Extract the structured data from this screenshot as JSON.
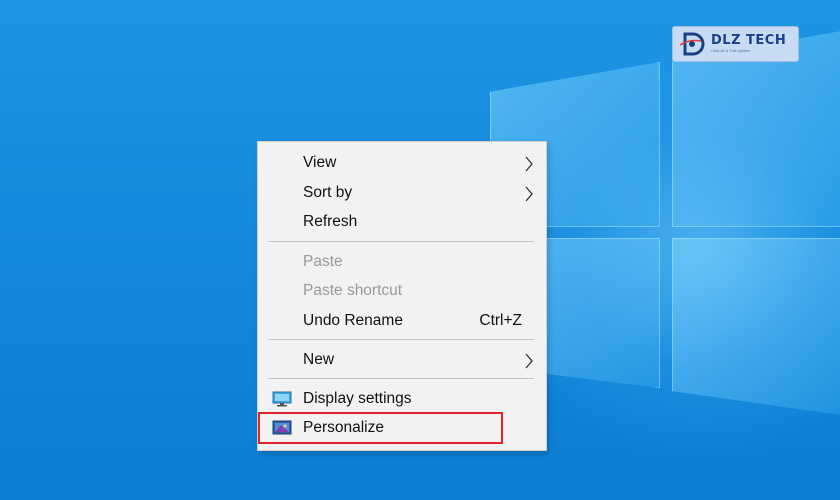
{
  "watermark": {
    "brand": "DLZ TECH",
    "tagline": "Chia sẻ & Trải nghiệm",
    "color": "#1c3f8a"
  },
  "context_menu": {
    "items": [
      {
        "label": "View",
        "submenu": true,
        "disabled": false
      },
      {
        "label": "Sort by",
        "submenu": true,
        "disabled": false
      },
      {
        "label": "Refresh",
        "submenu": false,
        "disabled": false
      },
      {
        "label": "Paste",
        "submenu": false,
        "disabled": true
      },
      {
        "label": "Paste shortcut",
        "submenu": false,
        "disabled": true
      },
      {
        "label": "Undo Rename",
        "shortcut": "Ctrl+Z",
        "submenu": false,
        "disabled": false
      },
      {
        "label": "New",
        "submenu": true,
        "disabled": false
      },
      {
        "label": "Display settings",
        "icon": "display-settings-icon",
        "submenu": false,
        "disabled": false
      },
      {
        "label": "Personalize",
        "icon": "personalize-icon",
        "submenu": false,
        "disabled": false,
        "highlighted": true
      }
    ],
    "highlight_color": "#e0242a"
  },
  "desktop": {
    "background_color": "#1589db"
  }
}
